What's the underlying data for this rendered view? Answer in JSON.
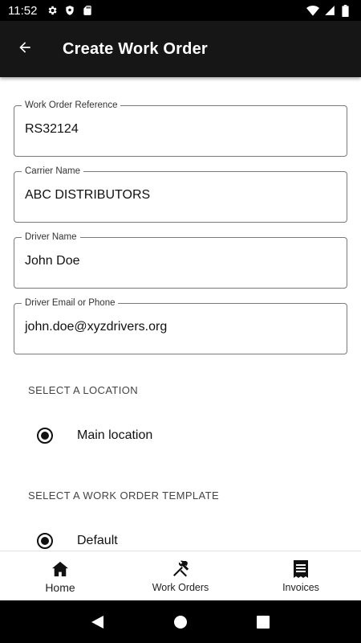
{
  "status_bar": {
    "time": "11:52",
    "left_icons": [
      "gear-icon",
      "shield-icon",
      "sd-card-icon"
    ],
    "right_icons": [
      "wifi-icon",
      "signal-icon",
      "battery-icon"
    ]
  },
  "app_bar": {
    "title": "Create Work Order",
    "back_icon": "arrow-back-icon"
  },
  "form": {
    "fields": [
      {
        "label": "Work Order Reference",
        "value": "RS32124"
      },
      {
        "label": "Carrier Name",
        "value": "ABC DISTRIBUTORS"
      },
      {
        "label": "Driver Name",
        "value": "John Doe"
      },
      {
        "label": "Driver Email or Phone",
        "value": "john.doe@xyzdrivers.org"
      }
    ],
    "location_section": {
      "title": "SELECT A LOCATION",
      "options": [
        {
          "label": "Main location",
          "selected": true
        }
      ]
    },
    "template_section": {
      "title": "SELECT A WORK ORDER TEMPLATE",
      "options": [
        {
          "label": "Default",
          "selected": true
        }
      ]
    }
  },
  "bottom_nav": {
    "items": [
      {
        "label": "Home",
        "icon": "home-icon",
        "active": true
      },
      {
        "label": "Work Orders",
        "icon": "tools-icon",
        "active": false
      },
      {
        "label": "Invoices",
        "icon": "receipt-icon",
        "active": false
      }
    ]
  },
  "system_nav": {
    "buttons": [
      "back-triangle-icon",
      "home-circle-icon",
      "recents-square-icon"
    ]
  }
}
